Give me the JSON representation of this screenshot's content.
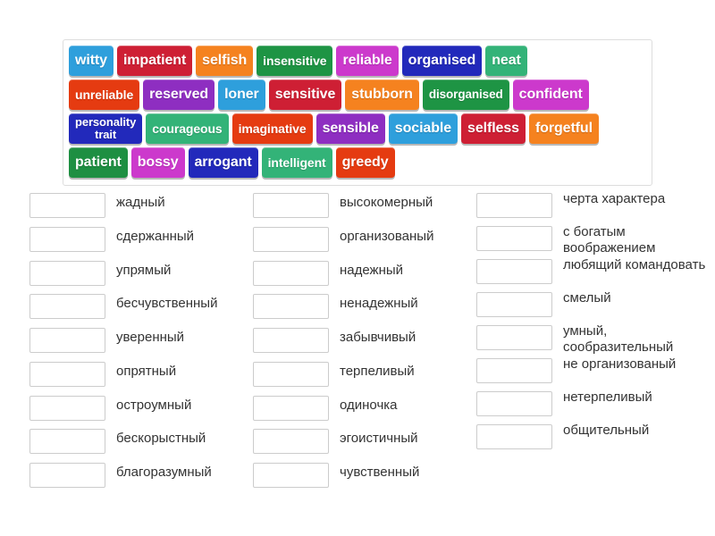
{
  "activity": {
    "type": "match-up-word-tiles",
    "language_pair": "English - Russian"
  },
  "tile_bank": {
    "name": "word-tile-bank",
    "rows": [
      [
        {
          "label": "witty",
          "color": "#2e9fdc"
        },
        {
          "label": "impatient",
          "color": "#ce1f34"
        },
        {
          "label": "selfish",
          "color": "#f5821f"
        },
        {
          "label": "insensitive",
          "color": "#1e9444"
        },
        {
          "label": "reliable",
          "color": "#cc39cc"
        },
        {
          "label": "organised",
          "color": "#2229bb"
        },
        {
          "label": "neat",
          "color": "#33b378"
        }
      ],
      [
        {
          "label": "unreliable",
          "color": "#e53b11"
        },
        {
          "label": "reserved",
          "color": "#8e2ec1"
        },
        {
          "label": "loner",
          "color": "#2e9fdc"
        },
        {
          "label": "sensitive",
          "color": "#ce1f34"
        },
        {
          "label": "stubborn",
          "color": "#f5821f"
        },
        {
          "label": "disorganised",
          "color": "#1e9444"
        },
        {
          "label": "confident",
          "color": "#cc39cc"
        }
      ],
      [
        {
          "label": "personality trait",
          "color": "#2229bb"
        },
        {
          "label": "courageous",
          "color": "#33b378"
        },
        {
          "label": "imaginative",
          "color": "#e53b11"
        },
        {
          "label": "sensible",
          "color": "#8e2ec1"
        },
        {
          "label": "sociable",
          "color": "#2e9fdc"
        },
        {
          "label": "selfless",
          "color": "#ce1f34"
        },
        {
          "label": "forgetful",
          "color": "#f5821f"
        }
      ],
      [
        {
          "label": "patient",
          "color": "#1e8f42"
        },
        {
          "label": "bossy",
          "color": "#cc39cc"
        },
        {
          "label": "arrogant",
          "color": "#2229bb"
        },
        {
          "label": "intelligent",
          "color": "#33b378"
        },
        {
          "label": "greedy",
          "color": "#e53b11"
        }
      ]
    ]
  },
  "answers": {
    "name": "answer-prompt-columns",
    "drop_placeholder": "",
    "columns": [
      {
        "name": "answer-column-1",
        "items": [
          "жадный",
          "сдержанный",
          "упрямый",
          "бесчувственный",
          "уверенный",
          "опрятный",
          "остроумный",
          "бескорыстный",
          "благоразумный"
        ]
      },
      {
        "name": "answer-column-2",
        "items": [
          "высокомерный",
          "организованый",
          "надежный",
          "ненадежный",
          "забывчивый",
          "терпеливый",
          "одиночка",
          "эгоистичный",
          "чувственный"
        ]
      },
      {
        "name": "answer-column-3",
        "items": [
          "черта характера",
          "с богатым воображением",
          "любящий командовать",
          "смелый",
          "умный, сообразительный",
          "не организованый",
          "нетерпеливый",
          "общительный"
        ]
      }
    ]
  },
  "theme": {
    "panel_border": "#dddddd",
    "drop_box_border": "#cccccc",
    "text_color": "#333333",
    "background": "#ffffff"
  }
}
